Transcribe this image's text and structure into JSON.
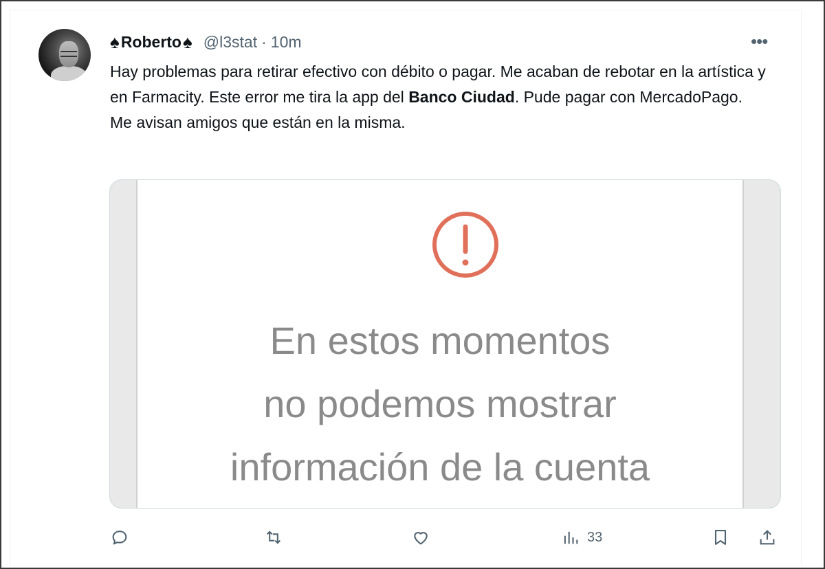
{
  "tweet": {
    "author": {
      "display_name": "Roberto",
      "decor_left": "♠",
      "decor_right": "♠",
      "handle": "@l3stat",
      "separator": "·",
      "time": "10m"
    },
    "more_label": "•••",
    "text": {
      "part1": "Hay problemas para retirar efectivo con débito o pagar. Me acaban de rebotar en la artística y en Farmacity. Este error me tira la app del ",
      "bold": "Banco Ciudad",
      "part2": ". Pude pagar con MercadoPago.",
      "line2": "Me avisan amigos que están en la misma."
    },
    "media": {
      "alert_icon": "exclamation-circle-icon",
      "alert_color": "#e0705a",
      "message_lines": [
        "En estos momentos",
        "no podemos mostrar",
        "información de la cuenta"
      ]
    },
    "actions": {
      "reply_icon": "reply-icon",
      "retweet_icon": "retweet-icon",
      "like_icon": "heart-icon",
      "views_icon": "analytics-icon",
      "views_count": "33",
      "bookmark_icon": "bookmark-icon",
      "share_icon": "share-icon"
    }
  }
}
